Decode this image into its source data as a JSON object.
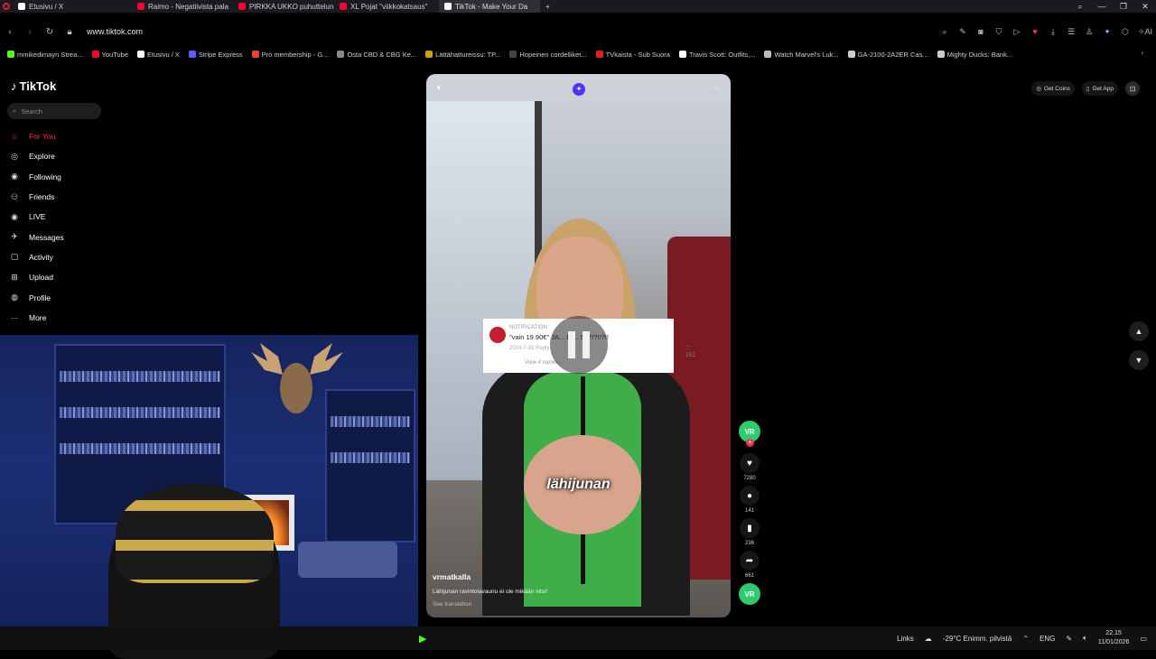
{
  "browser": {
    "tabs": [
      {
        "label": "Etusivu / X",
        "color": "#ffffff"
      },
      {
        "label": "Raimo - Negatiivista pala",
        "color": "#ff0033"
      },
      {
        "label": "PIRKKA UKKO puhuttelun",
        "color": "#ff0033"
      },
      {
        "label": "XL Pojat \"viikkokatsaus\"",
        "color": "#ff0033"
      },
      {
        "label": "TikTok - Make Your Da",
        "color": "#ffffff"
      }
    ],
    "new_tab": "+",
    "url": "www.tiktok.com",
    "bookmarks": [
      {
        "label": "mmikedimayn Strea...",
        "color": "#53fc18"
      },
      {
        "label": "YouTube",
        "color": "#ff0033"
      },
      {
        "label": "Etusivu / X",
        "color": "#ffffff"
      },
      {
        "label": "Stripe Express",
        "color": "#635bff"
      },
      {
        "label": "Pro membership - G...",
        "color": "#ea4335"
      },
      {
        "label": "Osta CBD & CBG Ke...",
        "color": "#888888"
      },
      {
        "label": "Lättähattureissu: TP...",
        "color": "#c8a400"
      },
      {
        "label": "Hopeinen cordelliket...",
        "color": "#444444"
      },
      {
        "label": "TVkaista - Sub Suora",
        "color": "#e02020"
      },
      {
        "label": "Travis Scott: Outfits,...",
        "color": "#ffffff"
      },
      {
        "label": "Watch Marvel's Luk...",
        "color": "#bbbbbb"
      },
      {
        "label": "GA-2100-2A2ER Cas...",
        "color": "#cccccc"
      },
      {
        "label": "Mighty Ducks: Bank...",
        "color": "#cccccc"
      }
    ]
  },
  "tiktok": {
    "logo": "TikTok",
    "search_placeholder": "Search",
    "menu": [
      {
        "label": "For You",
        "icon": "home-icon",
        "glyph": "⌂",
        "active": true
      },
      {
        "label": "Explore",
        "icon": "compass-icon",
        "glyph": "◎"
      },
      {
        "label": "Following",
        "icon": "following-avatar-icon",
        "glyph": "◉"
      },
      {
        "label": "Friends",
        "icon": "friends-icon",
        "glyph": "⚇"
      },
      {
        "label": "LIVE",
        "icon": "live-icon",
        "glyph": "◉"
      },
      {
        "label": "Messages",
        "icon": "messages-icon",
        "glyph": "✈"
      },
      {
        "label": "Activity",
        "icon": "activity-icon",
        "glyph": "▢"
      },
      {
        "label": "Upload",
        "icon": "upload-icon",
        "glyph": "⊞"
      },
      {
        "label": "Profile",
        "icon": "profile-icon",
        "glyph": "◍"
      },
      {
        "label": "More",
        "icon": "more-icon",
        "glyph": "···"
      }
    ],
    "top_right": {
      "get_coins": "Get Coins",
      "get_app": "Get App"
    },
    "video": {
      "comment_overlay": {
        "header": "NOTIFICATION",
        "text": "\"vain 19.90€\" JA... EI... 5€?!?!!?!!",
        "date": "2024-7-31",
        "reply": "Reply",
        "likes": "151",
        "view_more": "View 4 replies"
      },
      "caption": "lähijunan",
      "author": "vrmatkalla",
      "description": "Lähijunan ravintolavaunu ei ole mikään vitsi!",
      "see_translation": "See translation"
    },
    "actions": {
      "likes": "7280",
      "comments": "141",
      "saves": "236",
      "shares": "661",
      "avatar_label": "VR"
    }
  },
  "taskbar": {
    "links": "Links",
    "weather": "-29°C  Enimm. pilvistä",
    "lang": "ENG",
    "time": "22.15",
    "date": "11/01/2026"
  }
}
